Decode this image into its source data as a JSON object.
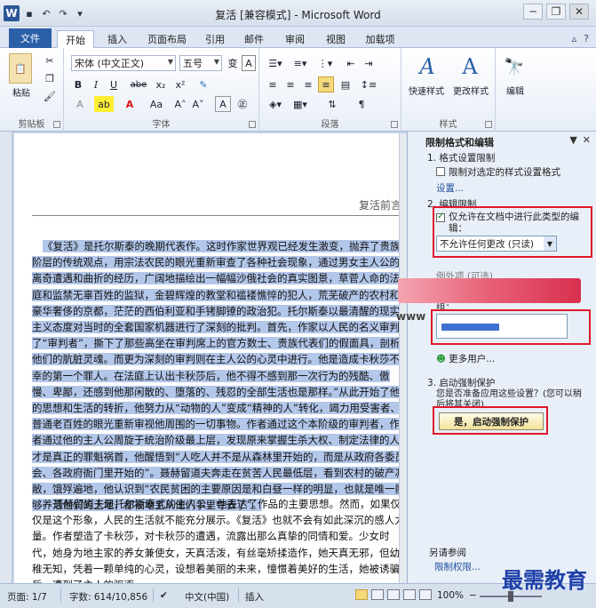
{
  "window": {
    "title": "复活 [兼容模式] - Microsoft Word",
    "logo": "W"
  },
  "qat": {
    "undo_glyph": "↶",
    "redo_glyph": "↷",
    "save_glyph": "▪",
    "more_glyph": "▾"
  },
  "tabs": [
    {
      "label": "文件"
    },
    {
      "label": "开始"
    },
    {
      "label": "插入"
    },
    {
      "label": "页面布局"
    },
    {
      "label": "引用"
    },
    {
      "label": "邮件"
    },
    {
      "label": "审阅"
    },
    {
      "label": "视图"
    },
    {
      "label": "加载项"
    }
  ],
  "ribbon": {
    "clipboard": {
      "label": "剪贴板",
      "paste": "粘贴"
    },
    "font": {
      "label": "字体",
      "font_name": "宋体 (中文正文)",
      "font_size": "五号",
      "bold": "B",
      "italic": "I",
      "underline": "U",
      "strike": "abe",
      "sub": "x₂",
      "sup": "x²"
    },
    "paragraph": {
      "label": "段落"
    },
    "styles": {
      "label": "样式",
      "quick": "快速样式",
      "change": "更改样式"
    },
    "editing": {
      "label": "编辑",
      "btn": "编辑"
    }
  },
  "document": {
    "header": "复活前言",
    "para1": "《复活》是托尔斯泰的晚期代表作。这时作家世界观已经发生激变，抛弃了贵族阶层的传统观点，用宗法农民的眼光重新审查了各种社会现象，通过男女主人公的离奇遭遇和曲折的经历，广阔地描绘出一幅幅沙俄社会的真实图景，草菅人命的法庭和监禁无辜百姓的监狱，金碧辉煌的教堂和褴褛憔悴的犯人，荒芜破产的农村和豪华奢侈的京都，茫茫的西伯利亚和手铐脚镣的政治犯。托尔斯泰以最清醒的现实主义态度对当时的全套国家机器进行了深刻的批判。首先，作家以人民的名义审判了“审判者”，撕下了那些高坐在审判席上的官方数士、贵族代表们的假面具，剖析他们的肮脏灵魂。而更为深刻的审判则在主人公的心灵中进行。他是造成卡秋莎不幸的第一个罪人。在法庭上认出卡秋莎后，他不得不感到那一次行为的残酷、傲慢、卑鄙，还感到他那闲散的、堕落的、残忍的全部生活也是那样。”从此开始了他的思想和生活的转折，他努力从“动物的人”变成“精神的人”转化，竭力用受害者、普通老百姓的眼光重新审视他周围的一切事物。作者通过这个本阶级的审判者，作者通过他的主人公周旋于统治阶级最上层，发现原来掌握生杀大权、制定法律的人才是真正的罪魁祸首，他醒悟到“人吃人并不是从森林里开始的，而是从政府各委员会、各政府衙门里开始的”。聂赫留道夫奔走在贫苦人民最低层，看到农村的破产凋敝，饿殍遍地，他认识到“农民贫困的主要原因是和白昼一样的明显，也就是唯一能够养活他们的土地，都被地主从他们手里夺去了”。",
    "para2": "聂赫留道夫是托尔斯泰式的主人公，他表达了作品的主要思想。然而，如果仅仅是这个形象，人民的生活就不能充分展示。《复活》也就不会有如此深沉的感人力量。作者塑造了卡秋莎，对卡秋莎的遭遇，流露出那么真挚的同情和爱。少女时代，她身为地主家的养女兼使女，天真活泼，有丝毫矫揉造作，她天真无邪，但幼稚无知，凭着一颗单纯的心灵，设想着美丽的未来，憧憬着美好的生活，她被诱骗后，遭到了主人的驱逐。"
  },
  "pane": {
    "title": "限制格式和编辑",
    "s1_head": "1. 格式设置限制",
    "s1_check": "限制对选定的样式设置格式",
    "s1_link": "设置...",
    "s2_head": "2. 编辑限制",
    "s2_check": "仅允许在文档中进行此类型的编辑：",
    "s2_select": "不允许任何更改 (只读)",
    "exceptions": "例外项 (可选)",
    "groups": "组：",
    "more_users": "更多用户...",
    "s3_head": "3. 启动强制保护",
    "s3_text": "您是否准备应用这些设置？(您可以稍后将其关闭)",
    "start_btn": "是，启动强制保护",
    "see_also": "另请参阅",
    "perm_link": "限制权限..."
  },
  "status": {
    "page": "页面: 1/7",
    "words": "字数: 614/10,856",
    "lang": "中文(中国)",
    "mode": "插入",
    "zoom": "100%"
  },
  "watermark": "最需教育",
  "www": "www"
}
